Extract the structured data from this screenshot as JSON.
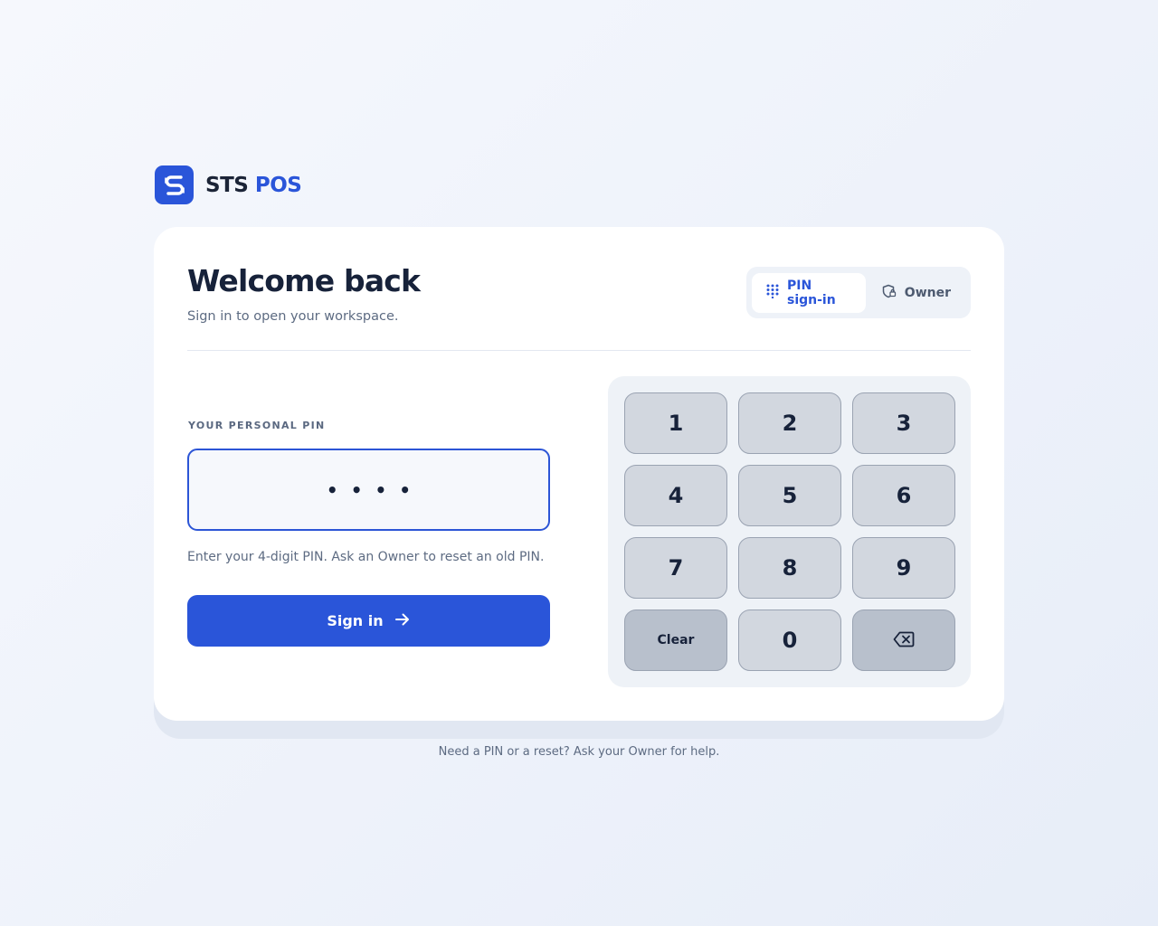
{
  "brand": {
    "word1": "STS",
    "word2": "POS",
    "icon": "sts-logo-icon",
    "color": "#2a55d9"
  },
  "header": {
    "title": "Welcome back",
    "subtitle": "Sign in to open your workspace."
  },
  "mode_toggle": {
    "active": "pin",
    "tabs": [
      {
        "label": "PIN sign-in",
        "icon": "keypad-grid-icon"
      },
      {
        "label": "Owner",
        "icon": "shield-lock-icon"
      }
    ]
  },
  "pin": {
    "label": "YOUR PERSONAL PIN",
    "masked_value": "••••",
    "hint": "Enter your 4-digit PIN. Ask an Owner to reset an old PIN."
  },
  "signin": {
    "label": "Sign in",
    "icon": "arrow-right-icon"
  },
  "keypad": {
    "keys": [
      "1",
      "2",
      "3",
      "4",
      "5",
      "6",
      "7",
      "8",
      "9",
      "Clear",
      "0",
      ""
    ],
    "backspace_icon": "backspace-icon"
  },
  "footer": {
    "text": "Need a PIN or a reset? Ask your Owner for help."
  },
  "colors": {
    "accent": "#2a55d9",
    "text": "#17223a",
    "muted": "#5d6b82"
  }
}
